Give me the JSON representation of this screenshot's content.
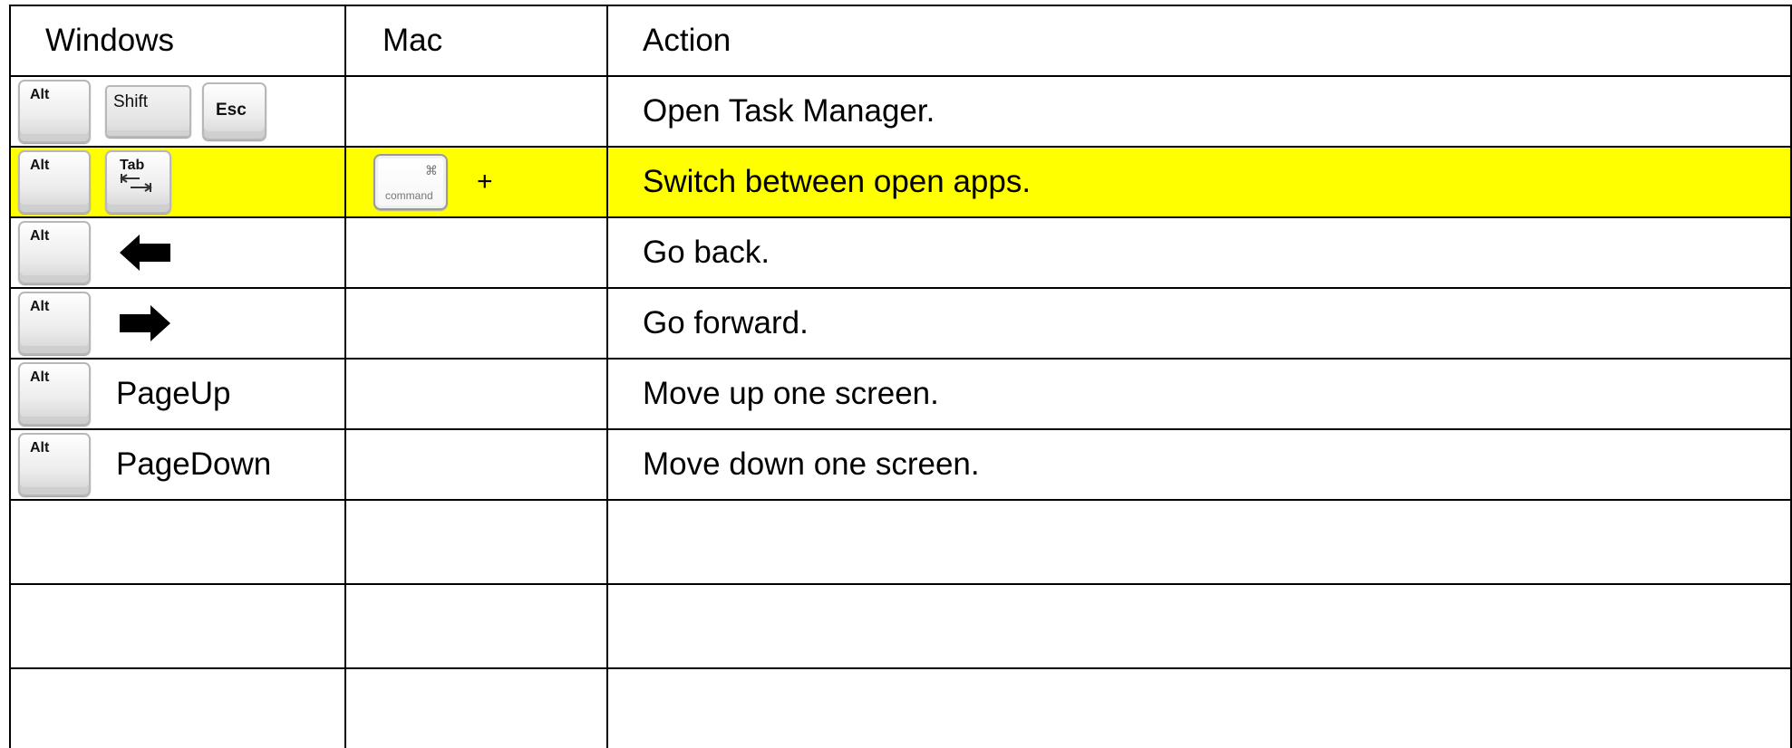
{
  "colors": {
    "highlight": "#ffff00",
    "border": "#000000"
  },
  "header": {
    "windows": "Windows",
    "mac": "Mac",
    "action": "Action"
  },
  "rows": [
    {
      "windows_keys": [
        "Alt",
        "Shift",
        "Esc"
      ],
      "mac": "",
      "action": "Open Task Manager."
    },
    {
      "windows_keys": [
        "Alt",
        "Tab"
      ],
      "mac_key": {
        "symbol": "⌘",
        "word": "command"
      },
      "mac_plus": "+",
      "action": "Switch between open apps.",
      "highlighted": true
    },
    {
      "windows_keys": [
        "Alt"
      ],
      "windows_icon": "left-arrow-icon",
      "action": "Go back."
    },
    {
      "windows_keys": [
        "Alt"
      ],
      "windows_icon": "right-arrow-icon",
      "action": "Go forward."
    },
    {
      "windows_keys": [
        "Alt"
      ],
      "windows_text": "PageUp",
      "action": "Move up one screen."
    },
    {
      "windows_keys": [
        "Alt"
      ],
      "windows_text": "PageDown",
      "action": "Move down one screen."
    }
  ],
  "empty_rows": 3
}
